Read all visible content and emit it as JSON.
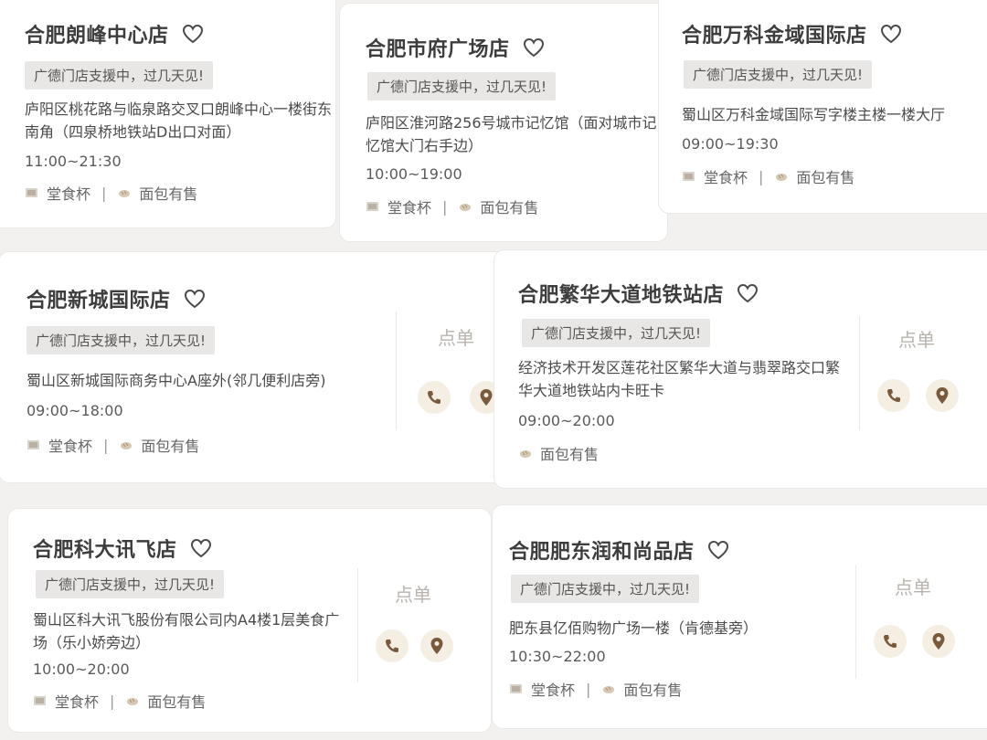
{
  "notice_text": "广德门店支援中，过几天见!",
  "tag_dine": "堂食杯",
  "tag_bread": "面包有售",
  "tag_sep": "|",
  "order_label": "点单",
  "stores": [
    {
      "name": "合肥朗峰中心店",
      "addr": "庐阳区桃花路与临泉路交叉口朗峰中心一楼街东南角（四泉桥地铁站D出口对面）",
      "hours": "11:00~21:30"
    },
    {
      "name": "合肥市府广场店",
      "addr": "庐阳区淮河路256号城市记忆馆（面对城市记忆馆大门右手边）",
      "hours": "10:00~19:00"
    },
    {
      "name": "合肥万科金域国际店",
      "addr": "蜀山区万科金域国际写字楼主楼一楼大厅",
      "hours": "09:00~19:30"
    },
    {
      "name": "合肥新城国际店",
      "addr": "蜀山区新城国际商务中心A座外(邻几便利店旁)",
      "hours": "09:00~18:00"
    },
    {
      "name": "合肥繁华大道地铁站店",
      "addr": "经济技术开发区莲花社区繁华大道与翡翠路交口繁华大道地铁站内卡旺卡",
      "hours": "09:00~20:00"
    },
    {
      "name": "合肥科大讯飞店",
      "addr": "蜀山区科大讯飞股份有限公司内A4楼1层美食广场（乐小娇旁边）",
      "hours": "10:00~20:00"
    },
    {
      "name": "合肥肥东润和尚品店",
      "addr": "肥东县亿佰购物广场一楼（肯德基旁）",
      "hours": "10:30~22:00"
    }
  ],
  "colors": {
    "icon_brown": "#7a5a3c",
    "icon_bg": "#f4eee3",
    "notice_bg": "#e9e7e5",
    "order_text": "#b8b3ad"
  }
}
